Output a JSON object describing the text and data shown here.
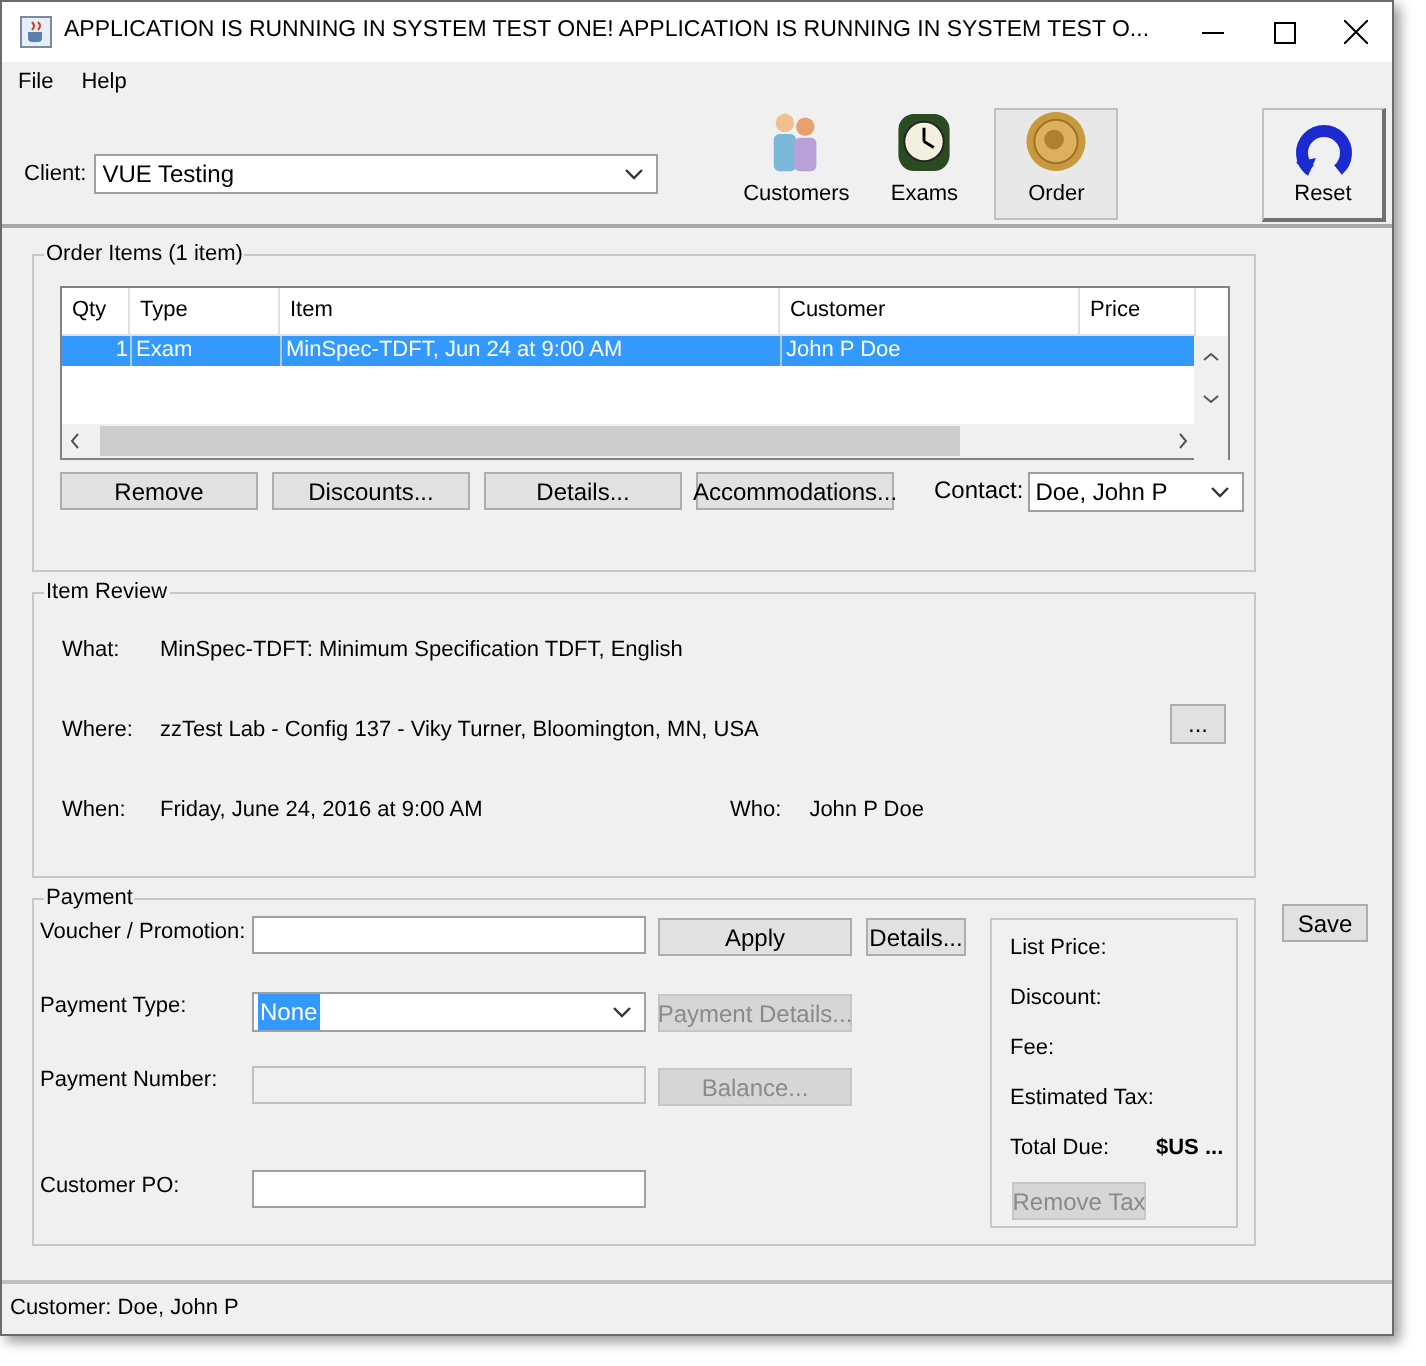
{
  "window": {
    "title": "APPLICATION IS RUNNING IN SYSTEM TEST ONE!  APPLICATION IS RUNNING IN SYSTEM TEST O..."
  },
  "menu": [
    "File",
    "Help"
  ],
  "client": {
    "label": "Client:",
    "value": "VUE Testing"
  },
  "toolbar": [
    {
      "label": "Customers",
      "kind": "people",
      "selected": false
    },
    {
      "label": "Exams",
      "kind": "clock",
      "selected": false
    },
    {
      "label": "Order",
      "kind": "coin",
      "selected": true
    }
  ],
  "reset": {
    "label": "Reset"
  },
  "order_items": {
    "title": "Order Items (1 item)",
    "columns": [
      "Qty",
      "Type",
      "Item",
      "Customer",
      "Price"
    ],
    "rows": [
      {
        "cells": [
          "1",
          "Exam",
          "MinSpec-TDFT, Jun 24 at 9:00 AM",
          "John P Doe"
        ],
        "selected": true
      }
    ],
    "buttons": [
      "Remove",
      "Discounts...",
      "Details...",
      "Accommodations..."
    ],
    "contact": {
      "label": "Contact:",
      "value": "Doe, John P"
    }
  },
  "item_review": {
    "title": "Item Review",
    "what_label": "What:",
    "what": "MinSpec-TDFT: Minimum Specification TDFT, English",
    "where_label": "Where:",
    "where": "zzTest Lab - Config 137 - Viky Turner, Bloomington, MN, USA",
    "where_button": "...",
    "when_label": "When:",
    "when": "Friday, June 24, 2016 at 9:00 AM",
    "who_label": "Who:",
    "who": "John P Doe"
  },
  "payment": {
    "title": "Payment",
    "voucher": {
      "label": "Voucher / Promotion:",
      "button": "Apply",
      "details_button": "Details..."
    },
    "payment_type": {
      "label": "Payment Type:",
      "value": "None",
      "button": "Payment Details...",
      "button_disabled": true
    },
    "payment_number": {
      "label": "Payment Number:",
      "disabled": true,
      "button": "Balance...",
      "button_disabled": true
    },
    "customer_po": {
      "label": "Customer PO:"
    },
    "summary": [
      {
        "label": "List Price:"
      },
      {
        "label": "Discount:"
      },
      {
        "label": "Fee:"
      },
      {
        "label": "Estimated Tax:"
      },
      {
        "label": "Total Due:",
        "value": "$US ..."
      }
    ],
    "remove_tax": {
      "label": "Remove Tax",
      "disabled": true
    }
  },
  "save": "Save",
  "status_bar": "Customer: Doe, John P"
}
